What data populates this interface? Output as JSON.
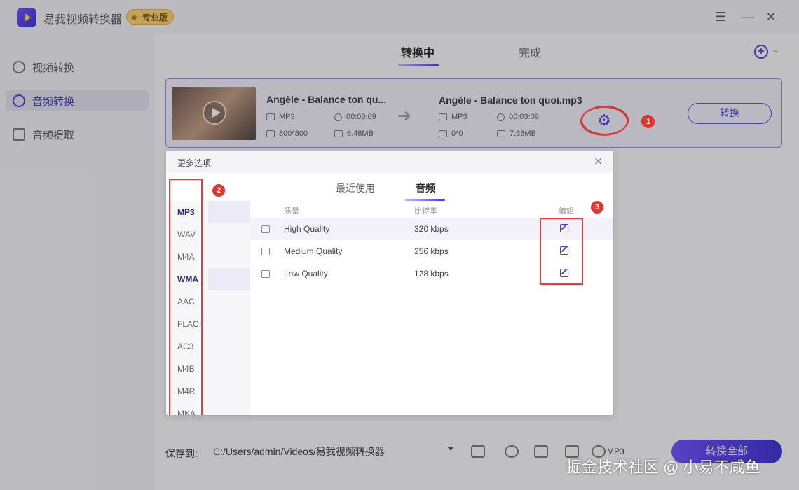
{
  "app": {
    "title": "易我视频转换器",
    "pro_badge": "专业版",
    "menu_icon": "menu-icon",
    "minimize_icon": "minimize-icon",
    "close_icon": "close-icon"
  },
  "sidebar": {
    "items": [
      {
        "label": "视频转换",
        "icon": "video-convert-icon",
        "active": false
      },
      {
        "label": "音频转换",
        "icon": "audio-convert-icon",
        "active": true
      },
      {
        "label": "音频提取",
        "icon": "audio-extract-icon",
        "active": false
      }
    ]
  },
  "main": {
    "tabs": [
      {
        "label": "转换中",
        "active": true
      },
      {
        "label": "完成",
        "active": false
      }
    ]
  },
  "file": {
    "source_name": "Angèle - Balance ton qu...",
    "source_format": "MP3",
    "source_duration": "00:03:09",
    "source_resolution": "800*800",
    "source_size": "6.48MB",
    "output_name": "Angèle - Balance ton quoi.mp3",
    "output_format": "MP3",
    "output_duration": "00:03:09",
    "output_resolution": "0*0",
    "output_size": "7.38MB",
    "convert_label": "转换"
  },
  "bottom": {
    "save_label": "保存到:",
    "path": "C:/Users/admin/Videos/易我视频转换器",
    "format_label": "MP3",
    "convert_all_label": "转换全部"
  },
  "modal": {
    "title": "更多选项",
    "tabs": [
      {
        "label": "最近使用",
        "active": false
      },
      {
        "label": "音频",
        "active": true
      }
    ],
    "formats": [
      "MP3",
      "WAV",
      "M4A",
      "WMA",
      "AAC",
      "FLAC",
      "AC3",
      "M4B",
      "M4R",
      "MKA"
    ],
    "columns": {
      "quality": "质量",
      "bitrate": "比特率",
      "edit": "编辑"
    },
    "rows": [
      {
        "name": "High Quality",
        "bitrate": "320 kbps"
      },
      {
        "name": "Medium Quality",
        "bitrate": "256 kbps"
      },
      {
        "name": "Low Quality",
        "bitrate": "128 kbps"
      }
    ]
  },
  "annotations": {
    "badge1": "1",
    "badge2": "2",
    "badge3": "3",
    "color": "#e8332f"
  },
  "watermark": "掘金技术社区 @ 小易不咸鱼"
}
